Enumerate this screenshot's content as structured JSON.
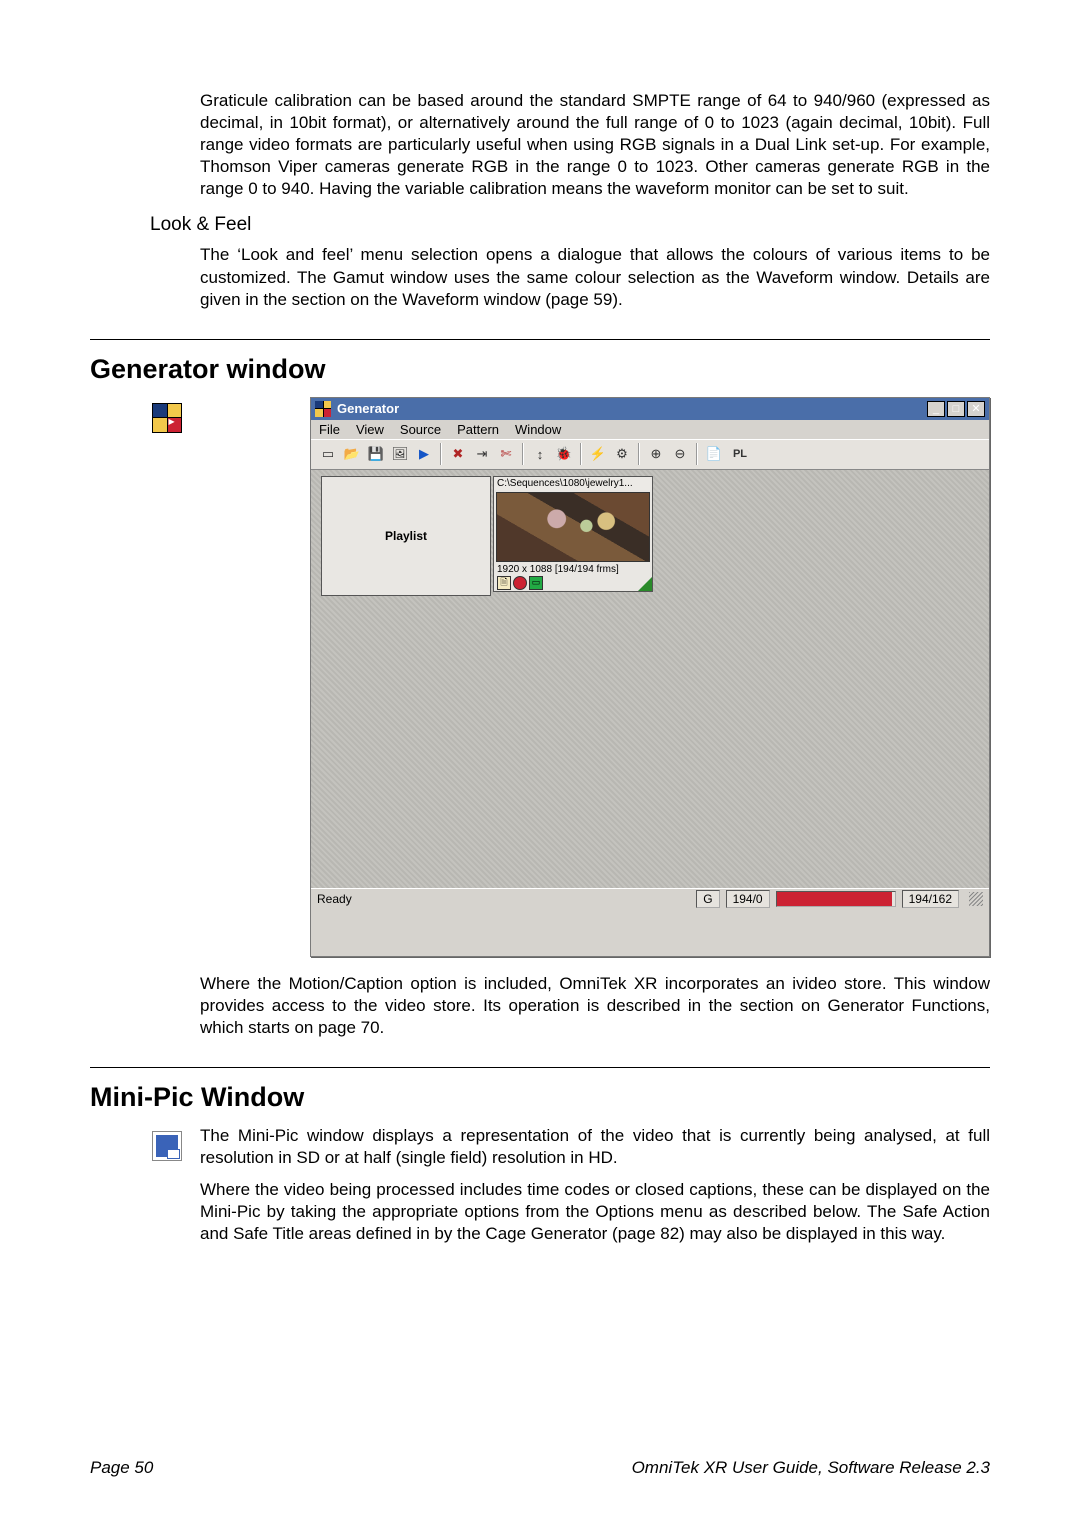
{
  "intro_para": "Graticule calibration can be based around the standard SMPTE range of 64 to 940/960 (expressed as decimal, in 10bit format), or alternatively around the full range of 0 to 1023 (again decimal, 10bit). Full range video formats are particularly useful when using RGB signals in a Dual Link set-up. For example, Thomson Viper cameras generate RGB in the range 0 to 1023. Other cameras generate RGB in the range 0 to 940. Having the variable calibration means the waveform monitor can be set to suit.",
  "look_feel_heading": "Look & Feel",
  "look_feel_para": "The ‘Look and feel’ menu selection opens a dialogue that allows the colours of various items to be customized. The Gamut window uses the same colour selection as the Waveform window. Details are given in the section on the Waveform window (page 59).",
  "generator_heading": "Generator window",
  "generator_para": "Where the Motion/Caption option is included, OmniTek XR incorporates an ivideo store. This window provides access to the video store. Its operation is described in the section on Generator Functions, which starts on page 70.",
  "minipic_heading": "Mini-Pic Window",
  "minipic_para1": "The Mini-Pic window displays a representation of the video that is currently being analysed, at full resolution in SD or at half (single field) resolution in HD.",
  "minipic_para2": "Where the video being processed includes time codes or closed captions, these can be displayed on the Mini-Pic by taking the appropriate options from the Options menu as described below. The Safe Action and Safe Title areas defined in by the Cage Generator (page 82) may also be displayed in this way.",
  "app": {
    "title": "Generator",
    "menus": [
      "File",
      "View",
      "Source",
      "Pattern",
      "Window"
    ],
    "toolbar": [
      {
        "name": "new-icon",
        "glyph": "▭"
      },
      {
        "name": "open-icon",
        "glyph": "📂"
      },
      {
        "name": "save-icon",
        "glyph": "💾"
      },
      {
        "name": "picture-icon",
        "glyph": "🖼"
      },
      {
        "name": "play-icon",
        "glyph": "▶",
        "cls": "play"
      },
      {
        "name": "sep"
      },
      {
        "name": "delete-icon",
        "glyph": "✖",
        "cls": "red"
      },
      {
        "name": "goto-end-icon",
        "glyph": "⇥"
      },
      {
        "name": "cut-icon",
        "glyph": "✄",
        "cls": "red"
      },
      {
        "name": "sep"
      },
      {
        "name": "resize-v-icon",
        "glyph": "↕"
      },
      {
        "name": "bug-icon",
        "glyph": "🐞"
      },
      {
        "name": "sep"
      },
      {
        "name": "speed-icon",
        "glyph": "⚡"
      },
      {
        "name": "gears-icon",
        "glyph": "⚙"
      },
      {
        "name": "sep"
      },
      {
        "name": "zoom-in-icon",
        "glyph": "⊕"
      },
      {
        "name": "zoom-out-icon",
        "glyph": "⊖"
      },
      {
        "name": "sep"
      },
      {
        "name": "list-icon",
        "glyph": "📄",
        "cls": "green"
      },
      {
        "name": "playlist-btn",
        "glyph": "PL",
        "cls": "pl"
      }
    ],
    "playlist_label": "Playlist",
    "clip": {
      "path": "C:\\Sequences\\1080\\jewelry1...",
      "meta": "1920 x 1088 [194/194 frms]"
    },
    "status": {
      "ready": "Ready",
      "g": "G",
      "counter1": "194/0",
      "counter2": "194/162"
    }
  },
  "footer": {
    "page": "Page 50",
    "doc": "OmniTek XR User Guide, Software Release 2.3"
  }
}
